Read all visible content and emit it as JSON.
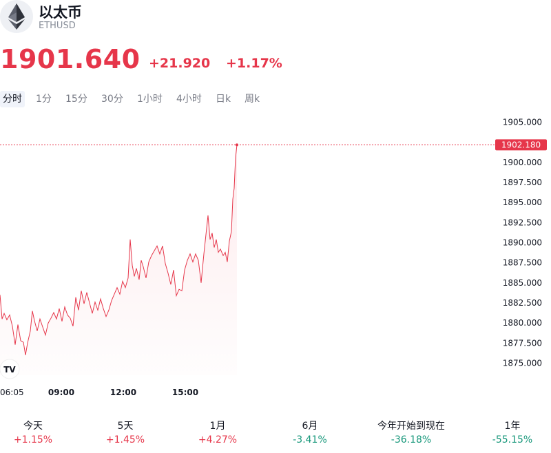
{
  "asset": {
    "name": "以太币",
    "symbol": "ETHUSD",
    "icon": "ethereum-icon"
  },
  "quote": {
    "price": "1901.640",
    "change": "+21.920",
    "change_pct": "+1.17%",
    "color": "#e6364a"
  },
  "tabs": [
    {
      "label": "分时",
      "active": true
    },
    {
      "label": "1分",
      "active": false
    },
    {
      "label": "15分",
      "active": false
    },
    {
      "label": "30分",
      "active": false
    },
    {
      "label": "1小时",
      "active": false
    },
    {
      "label": "4小时",
      "active": false
    },
    {
      "label": "日k",
      "active": false
    },
    {
      "label": "周k",
      "active": false
    }
  ],
  "chart_data": {
    "type": "area",
    "ylim": [
      1873.5,
      1906.5
    ],
    "y_ticks": [
      "1875.000",
      "1877.500",
      "1880.000",
      "1882.500",
      "1885.000",
      "1887.500",
      "1890.000",
      "1892.500",
      "1895.000",
      "1897.500",
      "1900.000",
      "1905.000"
    ],
    "x_ticks": [
      "06:05",
      "09:00",
      "12:00",
      "15:00"
    ],
    "last_price_label": "1902.180",
    "last_price": 1902.18,
    "line_color": "#e6364a",
    "points": [
      [
        0,
        1883.5
      ],
      [
        3,
        1880.5
      ],
      [
        6,
        1881.2
      ],
      [
        10,
        1880.4
      ],
      [
        14,
        1881.0
      ],
      [
        18,
        1879.6
      ],
      [
        22,
        1877.3
      ],
      [
        26,
        1879.8
      ],
      [
        30,
        1877.8
      ],
      [
        34,
        1877.6
      ],
      [
        37,
        1876.0
      ],
      [
        40,
        1877.5
      ],
      [
        44,
        1879.0
      ],
      [
        47,
        1881.5
      ],
      [
        50,
        1880.3
      ],
      [
        54,
        1879.0
      ],
      [
        58,
        1880.5
      ],
      [
        62,
        1879.5
      ],
      [
        66,
        1878.5
      ],
      [
        70,
        1880.0
      ],
      [
        74,
        1880.6
      ],
      [
        78,
        1881.3
      ],
      [
        82,
        1880.5
      ],
      [
        86,
        1881.8
      ],
      [
        90,
        1880.2
      ],
      [
        94,
        1882.0
      ],
      [
        98,
        1881.0
      ],
      [
        102,
        1880.6
      ],
      [
        106,
        1879.6
      ],
      [
        110,
        1883.2
      ],
      [
        114,
        1881.6
      ],
      [
        118,
        1884.0
      ],
      [
        122,
        1882.4
      ],
      [
        126,
        1883.8
      ],
      [
        130,
        1882.5
      ],
      [
        134,
        1881.2
      ],
      [
        138,
        1882.6
      ],
      [
        142,
        1881.6
      ],
      [
        146,
        1883.0
      ],
      [
        150,
        1881.8
      ],
      [
        154,
        1880.8
      ],
      [
        158,
        1881.6
      ],
      [
        162,
        1882.8
      ],
      [
        166,
        1883.6
      ],
      [
        170,
        1884.4
      ],
      [
        174,
        1883.6
      ],
      [
        178,
        1885.2
      ],
      [
        182,
        1884.4
      ],
      [
        186,
        1885.6
      ],
      [
        189,
        1890.4
      ],
      [
        192,
        1887.2
      ],
      [
        195,
        1885.8
      ],
      [
        198,
        1886.8
      ],
      [
        202,
        1885.4
      ],
      [
        205,
        1887.8
      ],
      [
        208,
        1887.0
      ],
      [
        212,
        1885.6
      ],
      [
        216,
        1887.6
      ],
      [
        220,
        1888.4
      ],
      [
        224,
        1889.0
      ],
      [
        228,
        1889.6
      ],
      [
        232,
        1888.6
      ],
      [
        236,
        1889.6
      ],
      [
        240,
        1887.4
      ],
      [
        244,
        1886.2
      ],
      [
        248,
        1884.8
      ],
      [
        252,
        1886.6
      ],
      [
        256,
        1883.4
      ],
      [
        260,
        1884.2
      ],
      [
        264,
        1884.0
      ],
      [
        268,
        1886.6
      ],
      [
        272,
        1887.8
      ],
      [
        276,
        1888.6
      ],
      [
        280,
        1887.6
      ],
      [
        284,
        1888.6
      ],
      [
        288,
        1887.8
      ],
      [
        292,
        1885.0
      ],
      [
        296,
        1888.6
      ],
      [
        300,
        1891.8
      ],
      [
        302,
        1893.4
      ],
      [
        305,
        1890.4
      ],
      [
        308,
        1891.2
      ],
      [
        311,
        1889.4
      ],
      [
        314,
        1890.4
      ],
      [
        317,
        1888.8
      ],
      [
        320,
        1889.2
      ],
      [
        324,
        1888.4
      ],
      [
        327,
        1888.8
      ],
      [
        330,
        1887.6
      ],
      [
        333,
        1890.2
      ],
      [
        336,
        1891.4
      ],
      [
        338,
        1895.4
      ],
      [
        340,
        1896.8
      ],
      [
        342,
        1900.6
      ],
      [
        344,
        1902.18
      ]
    ],
    "grid": false
  },
  "periods": [
    {
      "label": "今天",
      "value": "+1.15%",
      "dir": "up"
    },
    {
      "label": "5天",
      "value": "+1.45%",
      "dir": "up"
    },
    {
      "label": "1月",
      "value": "+4.27%",
      "dir": "up"
    },
    {
      "label": "6月",
      "value": "-3.41%",
      "dir": "down"
    },
    {
      "label": "今年开始到现在",
      "value": "-36.18%",
      "dir": "down"
    },
    {
      "label": "1年",
      "value": "-55.15%",
      "dir": "down"
    }
  ]
}
